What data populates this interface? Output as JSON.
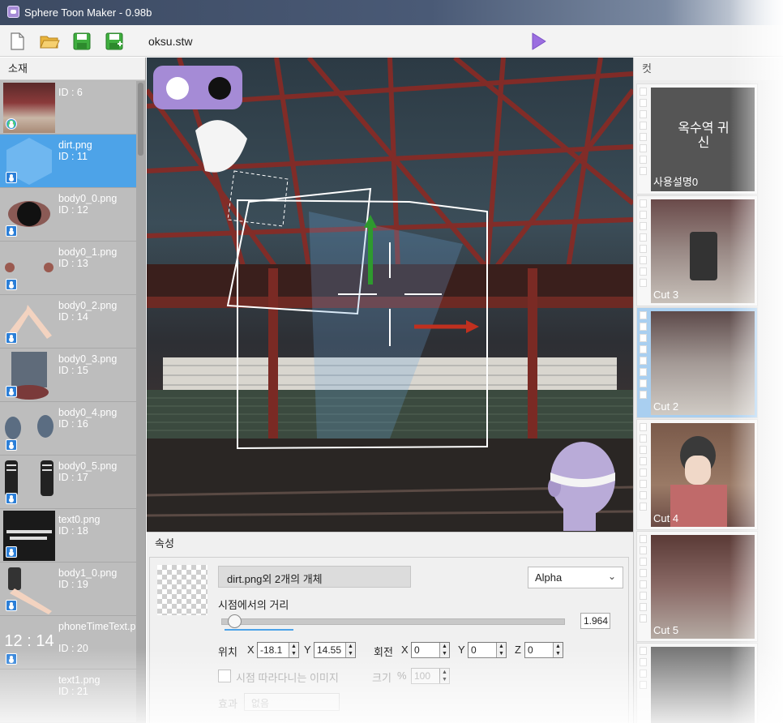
{
  "window": {
    "title": "Sphere Toon Maker - 0.98b"
  },
  "toolbar": {
    "filename": "oksu.stw",
    "icons": [
      "new-file-icon",
      "open-folder-icon",
      "save-icon",
      "save-as-icon",
      "play-icon"
    ],
    "colors": {
      "folder": "#f2c14e",
      "save": "#3fae3f",
      "play": "#9b6ee0"
    }
  },
  "assets": {
    "header": "소재",
    "items": [
      {
        "name": "",
        "id": "ID : 6"
      },
      {
        "name": "dirt.png",
        "id": "ID : 11",
        "selected": true
      },
      {
        "name": "body0_0.png",
        "id": "ID : 12"
      },
      {
        "name": "body0_1.png",
        "id": "ID : 13"
      },
      {
        "name": "body0_2.png",
        "id": "ID : 14"
      },
      {
        "name": "body0_3.png",
        "id": "ID : 15"
      },
      {
        "name": "body0_4.png",
        "id": "ID : 16"
      },
      {
        "name": "body0_5.png",
        "id": "ID : 17"
      },
      {
        "name": "text0.png",
        "id": "ID : 18"
      },
      {
        "name": "body1_0.png",
        "id": "ID : 19"
      },
      {
        "name": "phoneTimeText.png",
        "id": "ID : 20"
      },
      {
        "name": "text1.png",
        "id": "ID : 21"
      }
    ],
    "phone_time_thumb": "12 : 14"
  },
  "cuts": {
    "header": "컷",
    "items": [
      {
        "label": "사용설명0"
      },
      {
        "label": "Cut 3"
      },
      {
        "label": "Cut 2",
        "selected": true
      },
      {
        "label": "Cut 4"
      },
      {
        "label": "Cut 5"
      },
      {
        "label": ""
      }
    ],
    "title_art": "옥수역 귀신"
  },
  "properties": {
    "header": "속성",
    "object_name": "dirt.png외 2개의 개체",
    "blend_mode": "Alpha",
    "distance_label": "시점에서의 거리",
    "distance_value": "1.964",
    "distance_fraction": 0.04,
    "position_label": "위치",
    "pos_x_label": "X",
    "pos_x": "-18.1",
    "pos_y_label": "Y",
    "pos_y": "14.55",
    "rotation_label": "회전",
    "rot_x_label": "X",
    "rot_x": "0",
    "rot_y_label": "Y",
    "rot_y": "0",
    "rot_z_label": "Z",
    "rot_z": "0",
    "follow_label": "시점 따라다니는 이미지",
    "size_label": "크기",
    "size_unit": "%",
    "size_value": "100",
    "effect_label": "효과",
    "effect_value": "없음"
  }
}
